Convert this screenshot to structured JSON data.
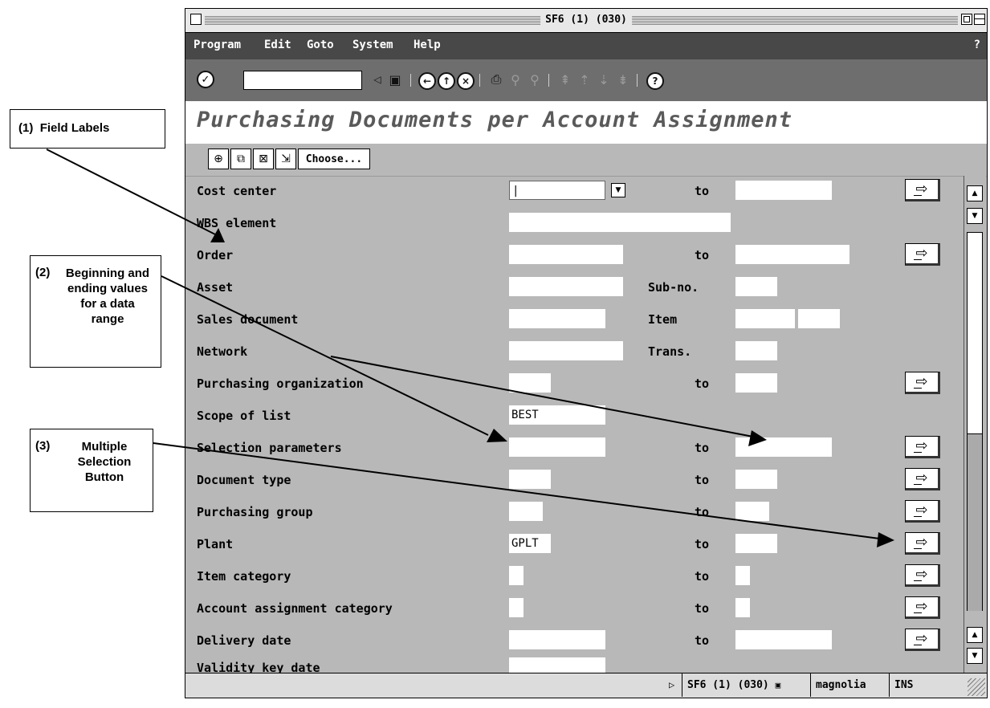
{
  "window": {
    "title": "SF6 (1) (030)"
  },
  "menu": {
    "items": [
      "Program",
      "Edit",
      "Goto",
      "System",
      "Help"
    ],
    "help": "?"
  },
  "toolbar": {
    "command_value": ""
  },
  "page_title": "Purchasing Documents per Account Assignment",
  "app_toolbar": {
    "choose_label": "Choose..."
  },
  "rows": [
    {
      "label": "Cost center",
      "low": "|",
      "mid": "to",
      "high": ""
    },
    {
      "label": "WBS element",
      "low": "",
      "mid": "",
      "high": ""
    },
    {
      "label": "Order",
      "low": "",
      "mid": "to",
      "high": ""
    },
    {
      "label": "Asset",
      "low": "",
      "mid": "Sub-no.",
      "high": ""
    },
    {
      "label": "Sales document",
      "low": "",
      "mid": "Item",
      "high": ""
    },
    {
      "label": "Network",
      "low": "",
      "mid": "Trans.",
      "high": ""
    },
    {
      "label": "Purchasing organization",
      "low": "",
      "mid": "to",
      "high": ""
    },
    {
      "label": "Scope of list",
      "low": "BEST",
      "mid": "",
      "high": ""
    },
    {
      "label": "Selection parameters",
      "low": "",
      "mid": "to",
      "high": ""
    },
    {
      "label": "Document type",
      "low": "",
      "mid": "to",
      "high": ""
    },
    {
      "label": "Purchasing group",
      "low": "",
      "mid": "to",
      "high": ""
    },
    {
      "label": "Plant",
      "low": "GPLT",
      "mid": "to",
      "high": ""
    },
    {
      "label": "Item category",
      "low": "",
      "mid": "to",
      "high": ""
    },
    {
      "label": "Account assignment category",
      "low": "",
      "mid": "to",
      "high": ""
    },
    {
      "label": "Delivery date",
      "low": "",
      "mid": "to",
      "high": ""
    },
    {
      "label": "Validity key date",
      "low": "",
      "mid": "",
      "high": ""
    }
  ],
  "status": {
    "session": "SF6 (1) (030)",
    "server": "magnolia",
    "mode": "INS"
  },
  "callouts": [
    {
      "number": "(1)",
      "text": "Field Labels"
    },
    {
      "number": "(2)",
      "text": "Beginning and ending values for a data range"
    },
    {
      "number": "(3)",
      "text": "Multiple Selection Button"
    }
  ]
}
